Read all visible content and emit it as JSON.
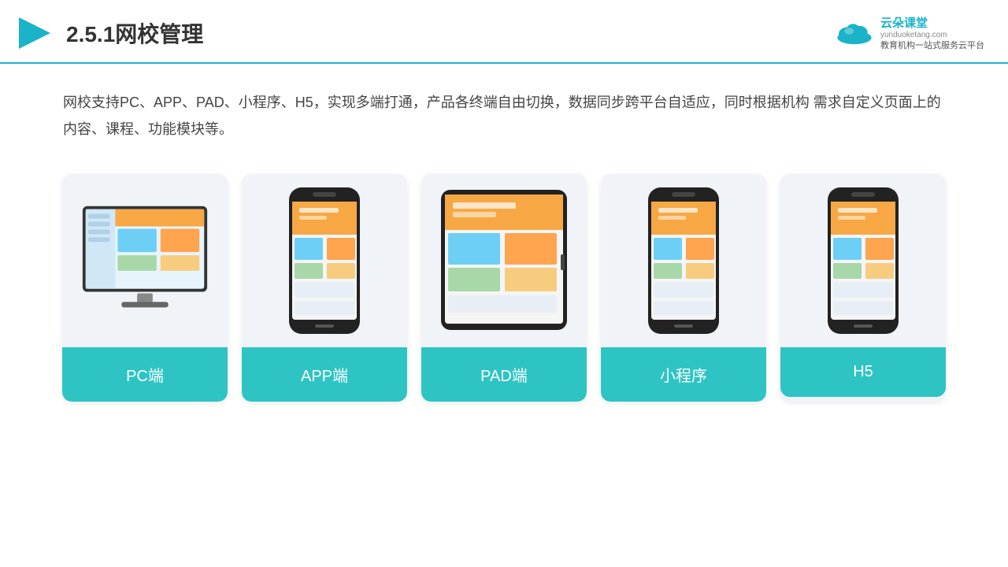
{
  "header": {
    "title": "2.5.1网校管理",
    "logo_name": "云朵课堂",
    "logo_url": "yunduoketang.com",
    "logo_subtitle": "教育机构一站\n式服务云平台"
  },
  "description": "网校支持PC、APP、PAD、小程序、H5，实现多端打通，产品各终端自由切换，数据同步跨平台自适应，同时根据机构\n需求自定义页面上的内容、课程、功能模块等。",
  "cards": [
    {
      "id": "pc",
      "label": "PC端"
    },
    {
      "id": "app",
      "label": "APP端"
    },
    {
      "id": "pad",
      "label": "PAD端"
    },
    {
      "id": "miniprogram",
      "label": "小程序"
    },
    {
      "id": "h5",
      "label": "H5"
    }
  ]
}
